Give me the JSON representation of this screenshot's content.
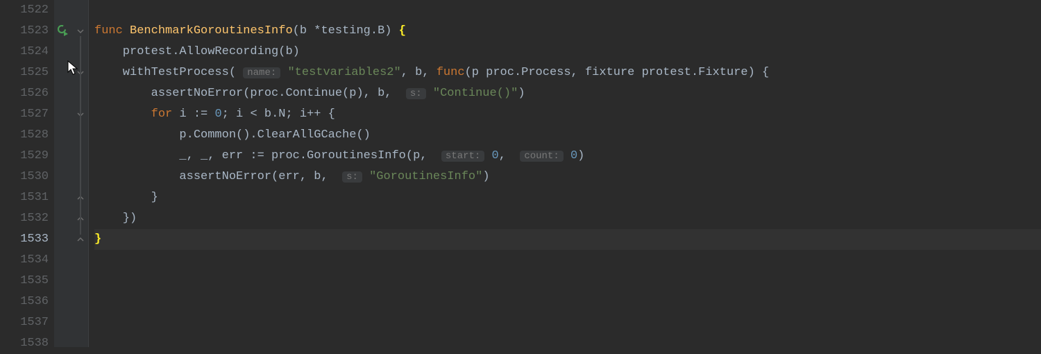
{
  "editor": {
    "language": "go",
    "active_line": 1533,
    "lines": [
      {
        "n": 1522,
        "run": false,
        "fold": null,
        "tokens": [
          {
            "t": "",
            "c": "c-def"
          }
        ]
      },
      {
        "n": 1523,
        "run": true,
        "fold": "open",
        "tokens": [
          {
            "t": "func ",
            "c": "c-kw"
          },
          {
            "t": "BenchmarkGoroutinesInfo",
            "c": "c-fn"
          },
          {
            "t": "(b *testing.B) ",
            "c": "c-def"
          },
          {
            "t": "{",
            "c": "c-brace-hl"
          }
        ]
      },
      {
        "n": 1524,
        "run": false,
        "fold": null,
        "tokens": [
          {
            "t": "    protest.AllowRecording(b)",
            "c": "c-def"
          }
        ]
      },
      {
        "n": 1525,
        "run": false,
        "fold": "open",
        "tokens": [
          {
            "t": "    withTestProcess( ",
            "c": "c-def"
          },
          {
            "t": "name:",
            "c": "c-hint"
          },
          {
            "t": " ",
            "c": "c-def"
          },
          {
            "t": "\"testvariables2\"",
            "c": "c-str"
          },
          {
            "t": ", b, ",
            "c": "c-def"
          },
          {
            "t": "func",
            "c": "c-kw"
          },
          {
            "t": "(p proc.Process, fixture protest.Fixture) {",
            "c": "c-def"
          }
        ]
      },
      {
        "n": 1526,
        "run": false,
        "fold": null,
        "tokens": [
          {
            "t": "        assertNoError(proc.Continue(p), b,  ",
            "c": "c-def"
          },
          {
            "t": "s:",
            "c": "c-hint"
          },
          {
            "t": " ",
            "c": "c-def"
          },
          {
            "t": "\"Continue()\"",
            "c": "c-str"
          },
          {
            "t": ")",
            "c": "c-def"
          }
        ]
      },
      {
        "n": 1527,
        "run": false,
        "fold": "open",
        "tokens": [
          {
            "t": "        ",
            "c": "c-def"
          },
          {
            "t": "for ",
            "c": "c-kw"
          },
          {
            "t": "i := ",
            "c": "c-def"
          },
          {
            "t": "0",
            "c": "c-num"
          },
          {
            "t": "; i < b.N; i++ {",
            "c": "c-def"
          }
        ]
      },
      {
        "n": 1528,
        "run": false,
        "fold": null,
        "tokens": [
          {
            "t": "            p.Common().ClearAllGCache()",
            "c": "c-def"
          }
        ]
      },
      {
        "n": 1529,
        "run": false,
        "fold": null,
        "tokens": [
          {
            "t": "            _, _, err := proc.GoroutinesInfo(p,  ",
            "c": "c-def"
          },
          {
            "t": "start:",
            "c": "c-hint"
          },
          {
            "t": " ",
            "c": "c-def"
          },
          {
            "t": "0",
            "c": "c-num"
          },
          {
            "t": ",  ",
            "c": "c-def"
          },
          {
            "t": "count:",
            "c": "c-hint"
          },
          {
            "t": " ",
            "c": "c-def"
          },
          {
            "t": "0",
            "c": "c-num"
          },
          {
            "t": ")",
            "c": "c-def"
          }
        ]
      },
      {
        "n": 1530,
        "run": false,
        "fold": null,
        "tokens": [
          {
            "t": "            assertNoError(err, b,  ",
            "c": "c-def"
          },
          {
            "t": "s:",
            "c": "c-hint"
          },
          {
            "t": " ",
            "c": "c-def"
          },
          {
            "t": "\"GoroutinesInfo\"",
            "c": "c-str"
          },
          {
            "t": ")",
            "c": "c-def"
          }
        ]
      },
      {
        "n": 1531,
        "run": false,
        "fold": "close",
        "tokens": [
          {
            "t": "        }",
            "c": "c-def"
          }
        ]
      },
      {
        "n": 1532,
        "run": false,
        "fold": "close",
        "tokens": [
          {
            "t": "    })",
            "c": "c-def"
          }
        ]
      },
      {
        "n": 1533,
        "run": false,
        "fold": "close",
        "active": true,
        "tokens": [
          {
            "t": "}",
            "c": "c-brace-hl"
          }
        ]
      },
      {
        "n": 1534,
        "run": false,
        "fold": null,
        "tokens": [
          {
            "t": "",
            "c": "c-def"
          }
        ]
      },
      {
        "n": 1535,
        "run": false,
        "fold": null,
        "tokens": [
          {
            "t": "",
            "c": "c-def"
          }
        ]
      },
      {
        "n": 1536,
        "run": false,
        "fold": null,
        "tokens": [
          {
            "t": "",
            "c": "c-def"
          }
        ]
      },
      {
        "n": 1537,
        "run": false,
        "fold": null,
        "tokens": [
          {
            "t": "",
            "c": "c-def"
          }
        ]
      },
      {
        "n": 1538,
        "run": false,
        "fold": null,
        "tokens": [
          {
            "t": "",
            "c": "c-def"
          }
        ]
      }
    ]
  }
}
